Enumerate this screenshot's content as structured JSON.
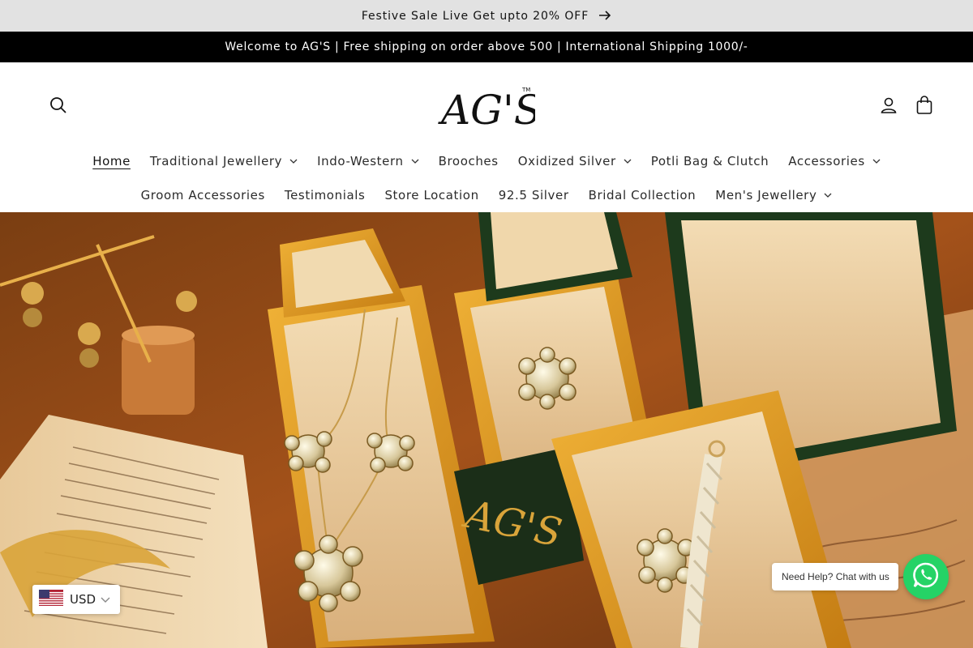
{
  "announcement": {
    "text": "Festive Sale Live Get upto 20% OFF",
    "arrow_icon": "arrow-right-icon"
  },
  "welcome_bar": {
    "text": "Welcome to AG'S | Free shipping on order above 500 | International Shipping 1000/-"
  },
  "header": {
    "logo_text": "AG'S",
    "logo_tm": "TM",
    "icons": [
      "search-icon",
      "account-icon",
      "cart-icon"
    ]
  },
  "nav": {
    "row1": [
      {
        "label": "Home",
        "dropdown": false,
        "active": true
      },
      {
        "label": "Traditional Jewellery",
        "dropdown": true
      },
      {
        "label": "Indo-Western",
        "dropdown": true
      },
      {
        "label": "Brooches",
        "dropdown": false
      },
      {
        "label": "Oxidized Silver",
        "dropdown": true
      },
      {
        "label": "Potli Bag & Clutch",
        "dropdown": false
      },
      {
        "label": "Accessories",
        "dropdown": true
      }
    ],
    "row2": [
      {
        "label": "Groom Accessories",
        "dropdown": false
      },
      {
        "label": "Testimonials",
        "dropdown": false
      },
      {
        "label": "Store Location",
        "dropdown": false
      },
      {
        "label": "92.5 Silver",
        "dropdown": false
      },
      {
        "label": "Bridal Collection",
        "dropdown": false
      },
      {
        "label": "Men's Jewellery",
        "dropdown": true
      }
    ]
  },
  "hero": {
    "box_brand": "AG'S",
    "book_lines": [
      "Sidney headed towards the Manette home",
      "concern, as she noticed that Mr",
      "after she had received Sidney Cart",
      "room. \"Are you unwell?\"",
      "lead a very healthy life.\"",
      "\"Pardon me if I'm in",
      "better to alter your w",
      "\"It is too late in",
      "to relate, as his eye",
      "I shall sink to",
      "\"Pl",
      "feel better"
    ]
  },
  "currency": {
    "code": "USD",
    "flag": "us-flag-icon"
  },
  "chat": {
    "tooltip": "Need Help? Chat with us",
    "icon": "whatsapp-icon"
  },
  "colors": {
    "announce_bg": "#e2e2e2",
    "welcome_bg": "#000000",
    "whatsapp": "#25d366",
    "hero_warm": "#b5651d"
  }
}
